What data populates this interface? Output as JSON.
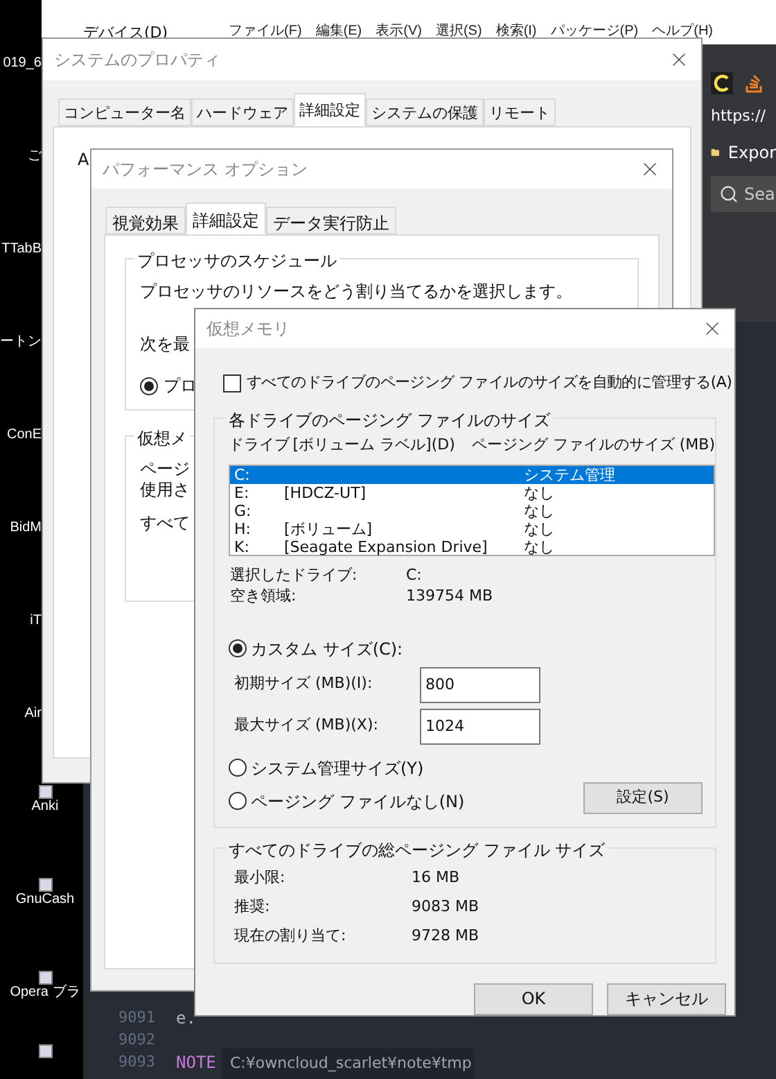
{
  "desktop_icons": [
    {
      "label": "019_6",
      "kind": "hidden"
    },
    {
      "label": "ご",
      "kind": "hidden"
    },
    {
      "label": "TTabB",
      "kind": "hidden"
    },
    {
      "label": "ートン",
      "kind": "hidden"
    },
    {
      "label": "ConE",
      "kind": "hidden"
    },
    {
      "label": "BidM",
      "kind": "hidden"
    },
    {
      "label": "iT",
      "kind": "hidden"
    },
    {
      "label": "Air",
      "kind": "hidden"
    },
    {
      "label": "Anki",
      "kind": "shown"
    },
    {
      "label": "GnuCash",
      "kind": "shown"
    },
    {
      "label": "Opera ブラ",
      "kind": "shown"
    },
    {
      "kind": "shown"
    }
  ],
  "explorer": {
    "menu_item": "デバイス(D)"
  },
  "editor": {
    "menu": [
      "ファイル(F)",
      "編集(E)",
      "表示(V)",
      "選択(S)",
      "検索(I)",
      "パッケージ(P)",
      "ヘルプ(H)"
    ],
    "lines": [
      {
        "number": "9091",
        "code": "e.",
        "kind": "plain"
      },
      {
        "number": "9092"
      },
      {
        "number": "9093",
        "code": "NOTE",
        "kind": "keyword"
      }
    ],
    "status_path": "C:¥owncloud_scarlet¥note¥tmp"
  },
  "browser": {
    "url": "https://",
    "bookmark": "Expor",
    "search_placeholder": "Sea"
  },
  "system_properties": {
    "title": "システムのプロパティ",
    "tabs": [
      {
        "label": "コンピューター名",
        "selected": false
      },
      {
        "label": "ハードウェア",
        "selected": false
      },
      {
        "label": "詳細設定",
        "selected": true
      },
      {
        "label": "システムの保護",
        "selected": false
      },
      {
        "label": "リモート",
        "selected": false
      }
    ],
    "fragment": "A"
  },
  "performance_options": {
    "title": "パフォーマンス オプション",
    "tabs": [
      {
        "label": "視覚効果",
        "selected": false
      },
      {
        "label": "詳細設定",
        "selected": true
      },
      {
        "label": "データ実行防止",
        "selected": false
      }
    ],
    "processor_group": {
      "label": "プロセッサのスケジュール",
      "description": "プロセッサのリソースをどう割り当てるかを選択します。",
      "prompt": "次を最",
      "option": {
        "label": "プロ",
        "selected": true
      }
    },
    "vm_group": {
      "label": "仮想メ",
      "lines": [
        "ページ",
        "使用さ",
        "すべて"
      ]
    }
  },
  "virtual_memory": {
    "title": "仮想メモリ",
    "auto_manage": {
      "label": "すべてのドライブのページング ファイルのサイズを自動的に管理する(A)",
      "checked": false
    },
    "drives_group": {
      "label": "各ドライブのページング ファイルのサイズ",
      "columns": [
        "ドライブ",
        "[ボリューム ラベル](D)",
        "ページング ファイルのサイズ (MB)"
      ],
      "rows": [
        {
          "drive": "C:",
          "size": "システム管理",
          "selected": true
        },
        {
          "drive": "E:",
          "volume": "[HDCZ-UT]",
          "size": "なし",
          "selected": false
        },
        {
          "drive": "G:",
          "size": "なし",
          "selected": false
        },
        {
          "drive": "H:",
          "volume": "[ボリューム]",
          "size": "なし",
          "selected": false
        },
        {
          "drive": "K:",
          "volume": "[Seagate Expansion Drive]",
          "size": "なし",
          "selected": false
        }
      ],
      "info": [
        {
          "label": "選択したドライブ:",
          "value": "C:"
        },
        {
          "label": "空き領域:",
          "value": "139754 MB"
        }
      ],
      "size_options": [
        {
          "label": "カスタム サイズ(C):",
          "selected": true
        },
        {
          "label": "システム管理サイズ(Y)",
          "selected": false
        },
        {
          "label": "ページング ファイルなし(N)",
          "selected": false
        }
      ],
      "fields": [
        {
          "label": "初期サイズ (MB)(I):",
          "value": "800"
        },
        {
          "label": "最大サイズ (MB)(X):",
          "value": "1024"
        }
      ],
      "set_button": "設定(S)"
    },
    "totals": {
      "label": "すべてのドライブの総ページング ファイル サイズ",
      "rows": [
        {
          "label": "最小限:",
          "value": "16 MB"
        },
        {
          "label": "推奨:",
          "value": "9083 MB"
        },
        {
          "label": "現在の割り当て:",
          "value": "9728 MB"
        }
      ]
    },
    "buttons": [
      "OK",
      "キャンセル"
    ]
  }
}
